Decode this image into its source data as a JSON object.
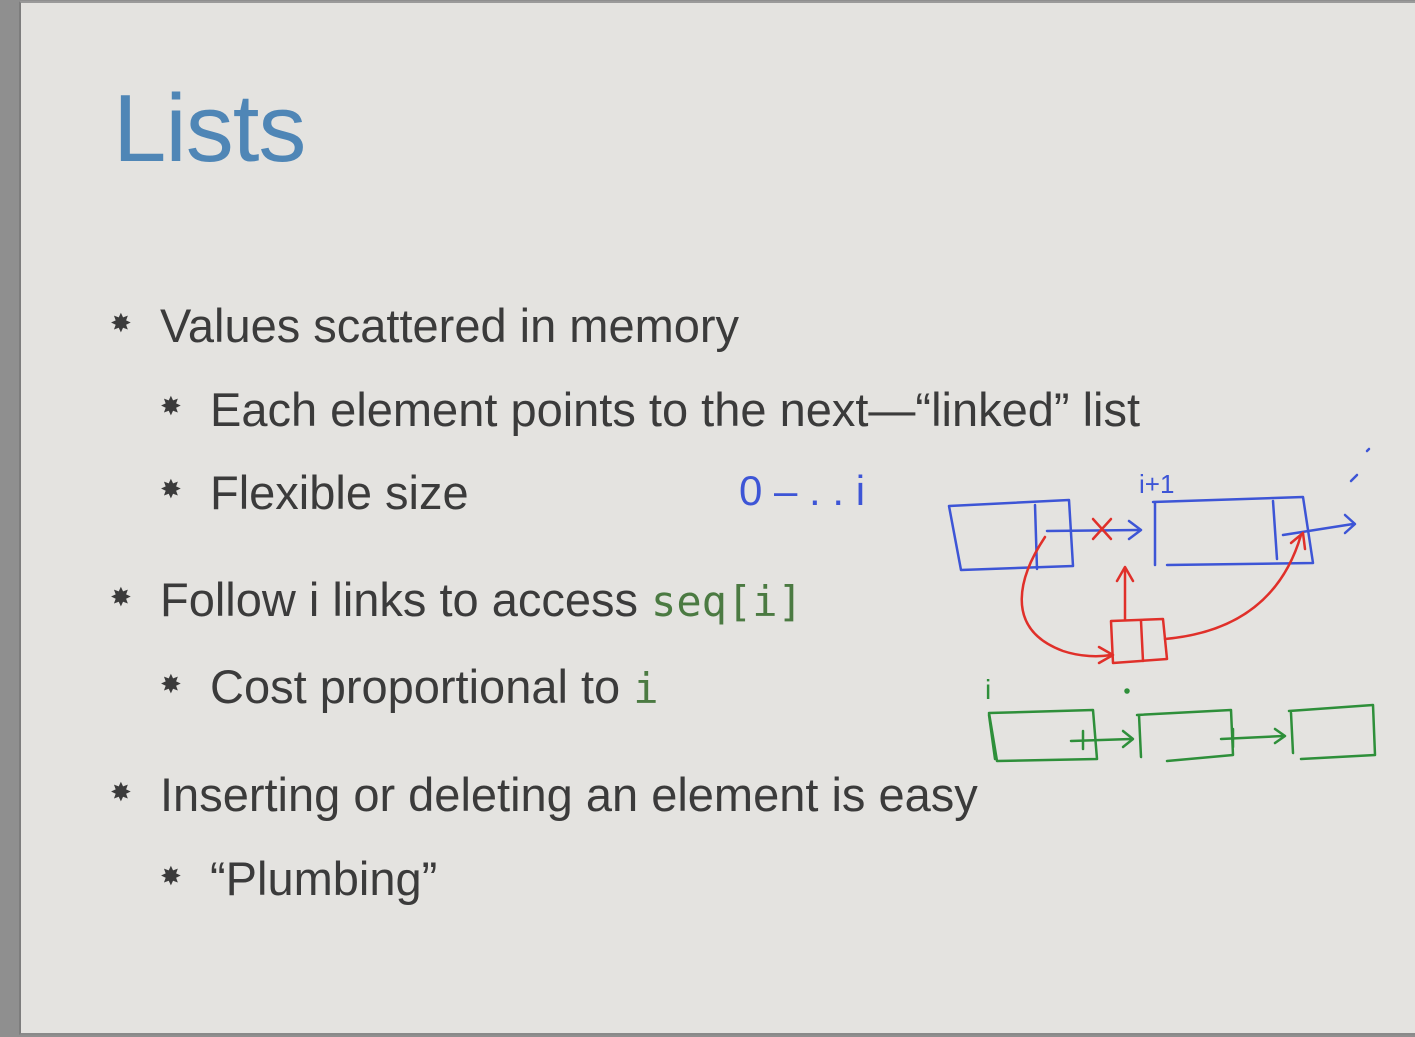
{
  "slide": {
    "title": "Lists",
    "bullets": [
      {
        "text": "Values scattered in memory",
        "level": 1
      },
      {
        "text": "Each element points to the next—“linked” list",
        "level": 2
      },
      {
        "text": "Flexible size",
        "level": 2
      },
      {
        "text": "Follow i links to access ",
        "code": "seq[i]",
        "level": 1
      },
      {
        "text": "Cost proportional to ",
        "code": "i",
        "level": 2
      },
      {
        "text": "Inserting or deleting an element is easy",
        "level": 1
      },
      {
        "text": "“Plumbing”",
        "level": 2
      }
    ],
    "bullet_glyph": "✸"
  },
  "annotations": {
    "range_label": "0 – . . i",
    "index_label": "i+1",
    "green_label": "i",
    "colors": {
      "blue": "#3d55d6",
      "red": "#e0302a",
      "green": "#2e8f3a"
    }
  }
}
